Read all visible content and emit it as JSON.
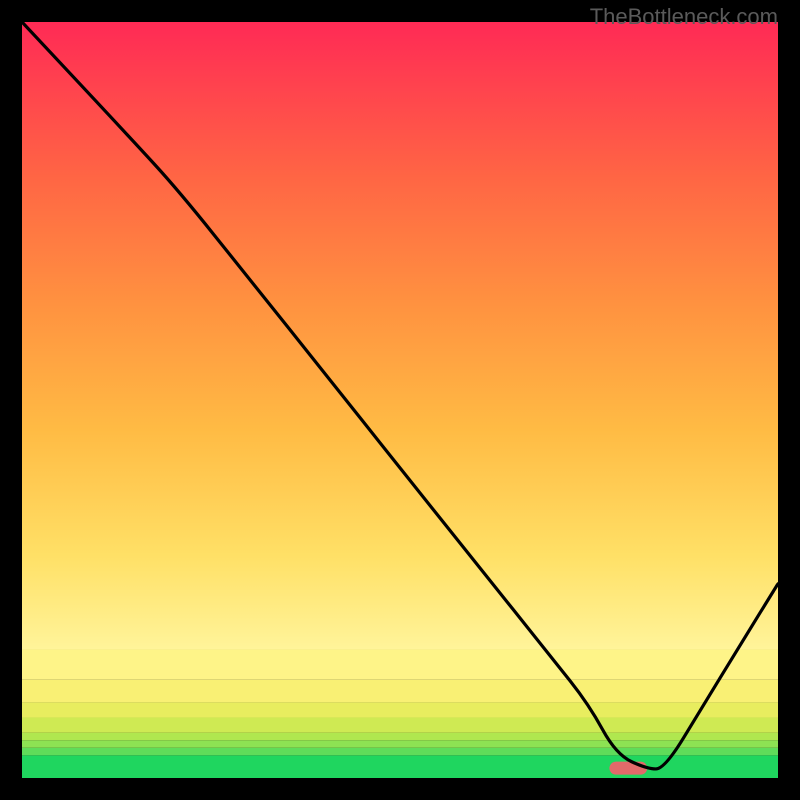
{
  "watermark": "TheBottleneck.com",
  "chart_data": {
    "type": "line",
    "title": "",
    "xlabel": "",
    "ylabel": "",
    "xlim": [
      0,
      100
    ],
    "ylim": [
      0,
      100
    ],
    "background_bands": [
      {
        "y0": 0,
        "y1": 3,
        "color": "#1fd65f"
      },
      {
        "y0": 3,
        "y1": 4,
        "color": "#5fdc5a"
      },
      {
        "y0": 4,
        "y1": 5,
        "color": "#8de253"
      },
      {
        "y0": 5,
        "y1": 6,
        "color": "#b0e74f"
      },
      {
        "y0": 6,
        "y1": 8,
        "color": "#cfea53"
      },
      {
        "y0": 8,
        "y1": 10,
        "color": "#e8ed5f"
      },
      {
        "y0": 10,
        "y1": 13,
        "color": "#f9f074"
      },
      {
        "y0": 13,
        "y1": 17,
        "color": "#fef488"
      },
      {
        "y0": 17,
        "y1": 100,
        "gradient": true
      }
    ],
    "series": [
      {
        "name": "bottleneck-curve",
        "color": "#000000",
        "x": [
          0.0,
          14.3,
          20.8,
          30.0,
          40.0,
          50.0,
          60.0,
          70.0,
          75.0,
          78.6,
          82.7,
          85.0,
          90.0,
          95.0,
          100.0
        ],
        "y": [
          100.0,
          84.7,
          77.6,
          66.1,
          53.6,
          41.0,
          28.5,
          16.0,
          9.7,
          3.1,
          1.2,
          1.2,
          9.4,
          17.6,
          25.7
        ]
      }
    ],
    "marker": {
      "name": "optimal-point",
      "x_center": 80.2,
      "width": 5.0,
      "color": "#e26a6a"
    }
  }
}
